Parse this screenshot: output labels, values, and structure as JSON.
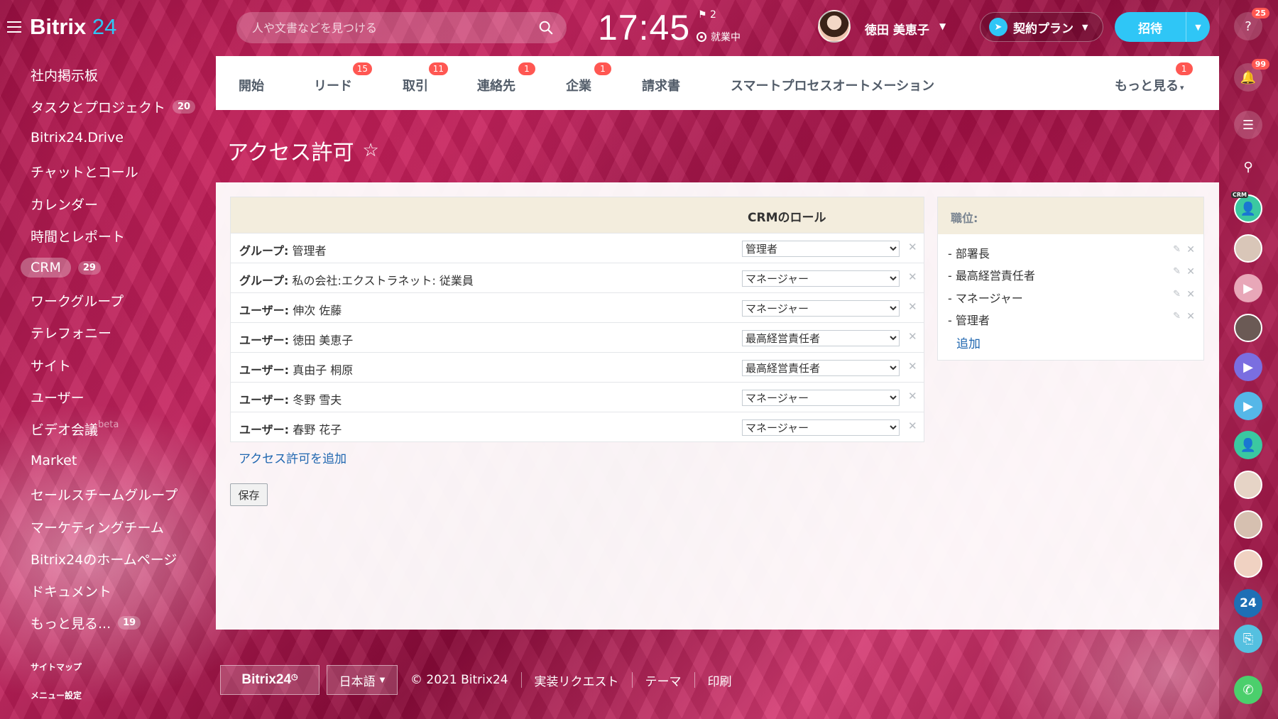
{
  "app": {
    "logo_main": "Bitrix",
    "logo_num": "24"
  },
  "header": {
    "search_placeholder": "人や文書などを見つける",
    "time": "17:45",
    "flag_count": "2",
    "work_status": "就業中",
    "user_name": "徳田 美恵子",
    "plan_label": "契約プラン",
    "invite_label": "招待"
  },
  "sidebar": {
    "items": [
      {
        "label": "社内掲示板"
      },
      {
        "label": "タスクとプロジェクト",
        "badge": "20"
      },
      {
        "label": "Bitrix24.Drive"
      },
      {
        "label": "チャットとコール"
      },
      {
        "label": "カレンダー"
      },
      {
        "label": "時間とレポート"
      },
      {
        "label": "CRM",
        "badge": "29"
      },
      {
        "label": "ワークグループ"
      },
      {
        "label": "テレフォニー"
      },
      {
        "label": "サイト"
      },
      {
        "label": "ユーザー"
      },
      {
        "label": "ビデオ会議",
        "extra": "beta"
      },
      {
        "label": "Market"
      },
      {
        "label": "セールスチームグループ"
      },
      {
        "label": "マーケティングチーム"
      },
      {
        "label": "Bitrix24のホームページ"
      },
      {
        "label": "ドキュメント"
      },
      {
        "label": "もっと見る...",
        "badge": "19"
      }
    ],
    "sitemap": "サイトマップ",
    "menu_settings": "メニュー設定"
  },
  "crm_nav": {
    "tabs": [
      {
        "label": "開始"
      },
      {
        "label": "リード",
        "count": "15"
      },
      {
        "label": "取引",
        "count": "11"
      },
      {
        "label": "連絡先",
        "count": "1"
      },
      {
        "label": "企業",
        "count": "1"
      },
      {
        "label": "請求書"
      },
      {
        "label": "スマートプロセスオートメーション"
      },
      {
        "label": "もっと見る",
        "count": "1"
      }
    ]
  },
  "page": {
    "title": "アクセス許可"
  },
  "roles": {
    "header": "CRMのロール",
    "rows": [
      {
        "type": "グループ:",
        "name": "管理者",
        "role": "管理者"
      },
      {
        "type": "グループ:",
        "name": "私の会社:エクストラネット: 従業員",
        "role": "マネージャー"
      },
      {
        "type": "ユーザー:",
        "name": "伸次 佐藤",
        "role": "マネージャー"
      },
      {
        "type": "ユーザー:",
        "name": "徳田 美恵子",
        "role": "最高経営責任者"
      },
      {
        "type": "ユーザー:",
        "name": "真由子 桐原",
        "role": "最高経営責任者"
      },
      {
        "type": "ユーザー:",
        "name": "冬野 雪夫",
        "role": "マネージャー"
      },
      {
        "type": "ユーザー:",
        "name": "春野 花子",
        "role": "マネージャー"
      }
    ],
    "role_options": [
      "管理者",
      "マネージャー",
      "最高経営責任者",
      "部署長"
    ],
    "add_link": "アクセス許可を追加",
    "save_label": "保存"
  },
  "positions": {
    "header": "職位:",
    "items": [
      "- 部署長",
      "- 最高経営責任者",
      "- マネージャー",
      "- 管理者"
    ],
    "add_label": "追加"
  },
  "footer": {
    "logo": "Bitrix24",
    "language": "日本語",
    "copyright": "© 2021 Bitrix24",
    "links": [
      "実装リクエスト",
      "テーマ",
      "印刷"
    ]
  },
  "rightbar": {
    "help_count": "25",
    "notify_count": "99",
    "badge_24": "24",
    "crm_tag": "CRM"
  },
  "colors": {
    "accent": "#2fc6f6",
    "counter": "#ff5752",
    "link": "#2067b0",
    "panel_header": "#f3eddd"
  }
}
